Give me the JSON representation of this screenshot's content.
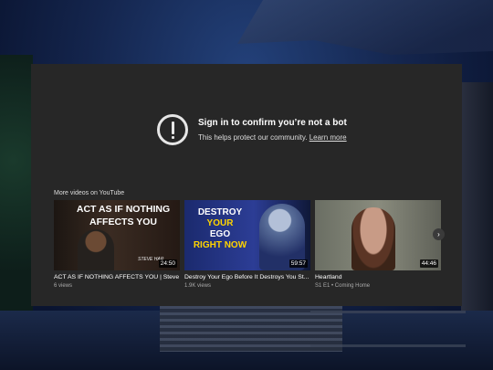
{
  "notice": {
    "title": "Sign in to confirm you’re not a bot",
    "subtitle": "This helps protect our community.",
    "link": "Learn more",
    "icon": "alert-circle-icon"
  },
  "more_videos": {
    "label": "More videos on YouTube",
    "next_icon": "chevron-right-icon",
    "next_symbol": "›",
    "cards": [
      {
        "thumb_lines": [
          "ACT AS IF NOTHING",
          "AFFECTS YOU"
        ],
        "thumb_signature": "STEVE HAR",
        "duration": "24:50",
        "title": "ACT AS IF NOTHING AFFECTS YOU | Steve ...",
        "meta": "6 views"
      },
      {
        "thumb_lines": [
          "DESTROY",
          "YOUR",
          "EGO",
          "RIGHT NOW"
        ],
        "duration": "59:57",
        "title": "Destroy Your Ego Before It Destroys You St...",
        "meta": "1.9K views"
      },
      {
        "duration": "44:46",
        "title": "Heartland",
        "meta": "S1 E1 • Coming Home"
      }
    ]
  }
}
